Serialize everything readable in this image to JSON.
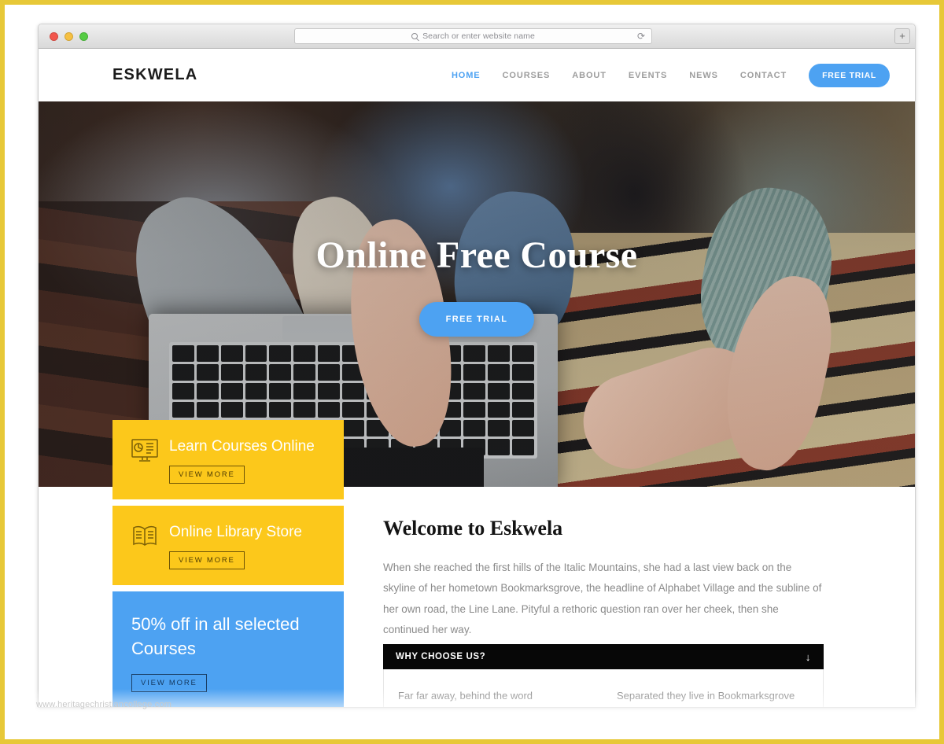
{
  "browser": {
    "address_placeholder": "Search or enter website name",
    "search_icon": "search-icon",
    "reload_icon": "reload-icon",
    "newtab_label": "+",
    "traffic_lights": [
      "close-red",
      "minimize-yellow",
      "zoom-green"
    ]
  },
  "site": {
    "brand": "ESKWELA",
    "nav": [
      {
        "label": "HOME",
        "active": true
      },
      {
        "label": "COURSES",
        "active": false
      },
      {
        "label": "ABOUT",
        "active": false
      },
      {
        "label": "EVENTS",
        "active": false
      },
      {
        "label": "NEWS",
        "active": false
      },
      {
        "label": "CONTACT",
        "active": false
      }
    ],
    "nav_cta": "FREE TRIAL",
    "hero": {
      "title": "Online Free Course",
      "cta": "FREE TRIAL"
    },
    "promos": [
      {
        "title": "Learn Courses Online",
        "cta": "VIEW MORE",
        "icon": "monitor-chart-icon",
        "color": "#fcc81b"
      },
      {
        "title": "Online Library Store",
        "cta": "VIEW MORE",
        "icon": "open-book-icon",
        "color": "#fcc81b"
      },
      {
        "title": "50% off in all selected Courses",
        "cta": "VIEW MORE",
        "icon": "",
        "color": "#4da2f2"
      }
    ],
    "welcome": {
      "title": "Welcome to Eskwela",
      "body": "When she reached the first hills of the Italic Mountains, she had a last view back on the skyline of her hometown Bookmarksgrove, the headline of Alphabet Village and the subline of her own road, the Line Lane. Pityful a rethoric question ran over her cheek, then she continued her way."
    },
    "accordion": {
      "title": "WHY CHOOSE US?",
      "arrow": "↓",
      "columns": [
        "Far far away, behind the word",
        "Separated they live in Bookmarksgrove"
      ]
    }
  },
  "watermark": "www.heritagechristiancollege.com",
  "colors": {
    "accent_blue": "#4da2f2",
    "accent_yellow": "#fcc81b",
    "frame_gold": "#e7c838",
    "dark": "#070707"
  }
}
